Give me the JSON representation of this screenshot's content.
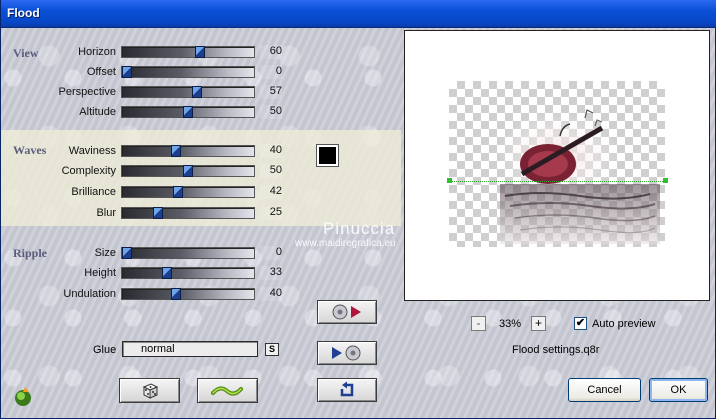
{
  "window": {
    "title": "Flood"
  },
  "sections": {
    "view": "View",
    "waves": "Waves",
    "ripple": "Ripple"
  },
  "params": {
    "horizon": {
      "label": "Horizon",
      "value": "60",
      "level": 0.6
    },
    "offset": {
      "label": "Offset",
      "value": "0",
      "level": 0.0
    },
    "perspective": {
      "label": "Perspective",
      "value": "57",
      "level": 0.57
    },
    "altitude": {
      "label": "Altitude",
      "value": "50",
      "level": 0.5
    },
    "waviness": {
      "label": "Waviness",
      "value": "40",
      "level": 0.4
    },
    "complexity": {
      "label": "Complexity",
      "value": "50",
      "level": 0.5
    },
    "brilliance": {
      "label": "Brilliance",
      "value": "42",
      "level": 0.42
    },
    "blur": {
      "label": "Blur",
      "value": "25",
      "level": 0.25
    },
    "size": {
      "label": "Size",
      "value": "0",
      "level": 0.0
    },
    "height": {
      "label": "Height",
      "value": "33",
      "level": 0.33
    },
    "undulation": {
      "label": "Undulation",
      "value": "40",
      "level": 0.4
    }
  },
  "waves_color": "#000000",
  "glue": {
    "label": "Glue",
    "value": "normal",
    "s_button": "S"
  },
  "zoom": {
    "minus": "-",
    "value": "33%",
    "plus": "+"
  },
  "auto_preview": {
    "label": "Auto preview",
    "checked": true,
    "mark": "✔"
  },
  "settings_file": "Flood settings.q8r",
  "buttons": {
    "cancel": "Cancel",
    "ok": "OK"
  },
  "watermark": {
    "name": "Pinuccia",
    "url": "www.maidiregrafica.eu"
  },
  "icons": {
    "plugin": "filters-unlimited-icon",
    "random": "dice-icon",
    "wave": "wave-icon",
    "load_preset": "load-preset-icon",
    "save_preset": "save-preset-icon",
    "reset": "reset-icon"
  }
}
